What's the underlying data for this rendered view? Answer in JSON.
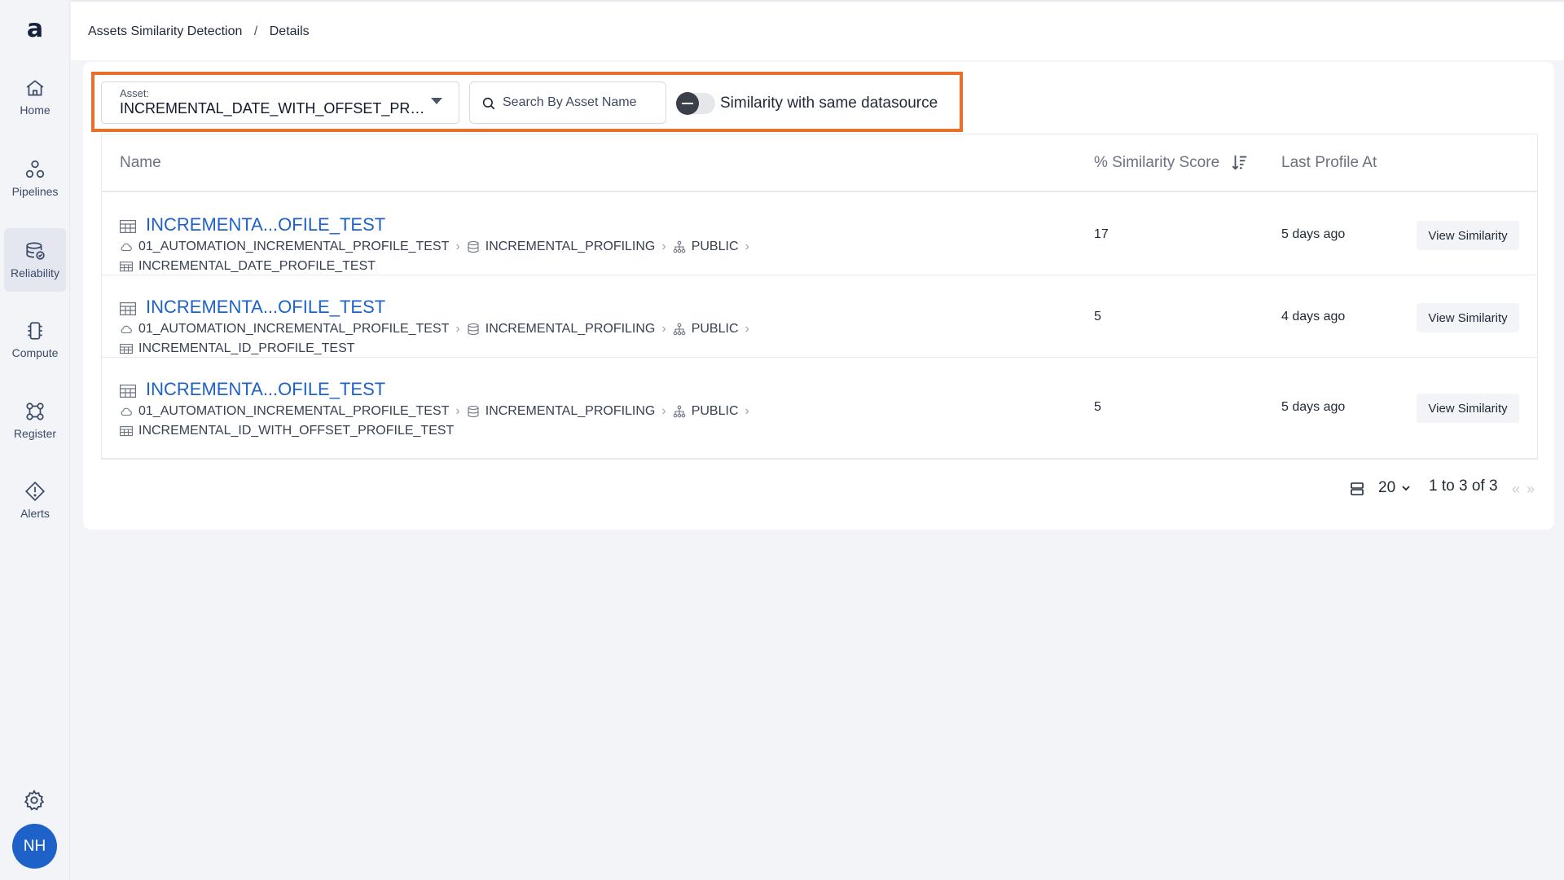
{
  "brand": {
    "logo_text": "a"
  },
  "sidebar": {
    "items": [
      {
        "label": "Home",
        "icon": "home-icon"
      },
      {
        "label": "Pipelines",
        "icon": "pipelines-icon"
      },
      {
        "label": "Reliability",
        "icon": "reliability-icon",
        "active": true
      },
      {
        "label": "Compute",
        "icon": "compute-icon"
      },
      {
        "label": "Register",
        "icon": "register-icon"
      },
      {
        "label": "Alerts",
        "icon": "alerts-icon"
      }
    ],
    "user_initials": "NH"
  },
  "breadcrumb": {
    "root": "Assets Similarity Detection",
    "separator": "/",
    "current": "Details"
  },
  "filters": {
    "asset_label": "Asset:",
    "asset_value": "INCREMENTAL_DATE_WITH_OFFSET_PROFILE_TEST",
    "search_placeholder": "Search By Asset Name",
    "toggle_label": "Similarity with same datasource",
    "toggle_on": false
  },
  "table": {
    "columns": {
      "name": "Name",
      "score": "% Similarity Score",
      "last_profile": "Last Profile At"
    },
    "rows": [
      {
        "name": "INCREMENTA...OFILE_TEST",
        "datasource": "01_AUTOMATION_INCREMENTAL_PROFILE_TEST",
        "database": "INCREMENTAL_PROFILING",
        "schema": "PUBLIC",
        "table": "INCREMENTAL_DATE_PROFILE_TEST",
        "score": "17",
        "last_profile": "5 days ago",
        "action": "View Similarity"
      },
      {
        "name": "INCREMENTA...OFILE_TEST",
        "datasource": "01_AUTOMATION_INCREMENTAL_PROFILE_TEST",
        "database": "INCREMENTAL_PROFILING",
        "schema": "PUBLIC",
        "table": "INCREMENTAL_ID_PROFILE_TEST",
        "score": "5",
        "last_profile": "4 days ago",
        "action": "View Similarity"
      },
      {
        "name": "INCREMENTA...OFILE_TEST",
        "datasource": "01_AUTOMATION_INCREMENTAL_PROFILE_TEST",
        "database": "INCREMENTAL_PROFILING",
        "schema": "PUBLIC",
        "table": "INCREMENTAL_ID_WITH_OFFSET_PROFILE_TEST",
        "score": "5",
        "last_profile": "5 days ago",
        "action": "View Similarity"
      }
    ]
  },
  "pagination": {
    "page_size": "20",
    "summary": "1 to 3 of 3",
    "prev": "«",
    "next": "»"
  },
  "colors": {
    "accent": "#1e62c9",
    "highlight_border": "#e8702a",
    "avatar": "#1e62c9"
  }
}
